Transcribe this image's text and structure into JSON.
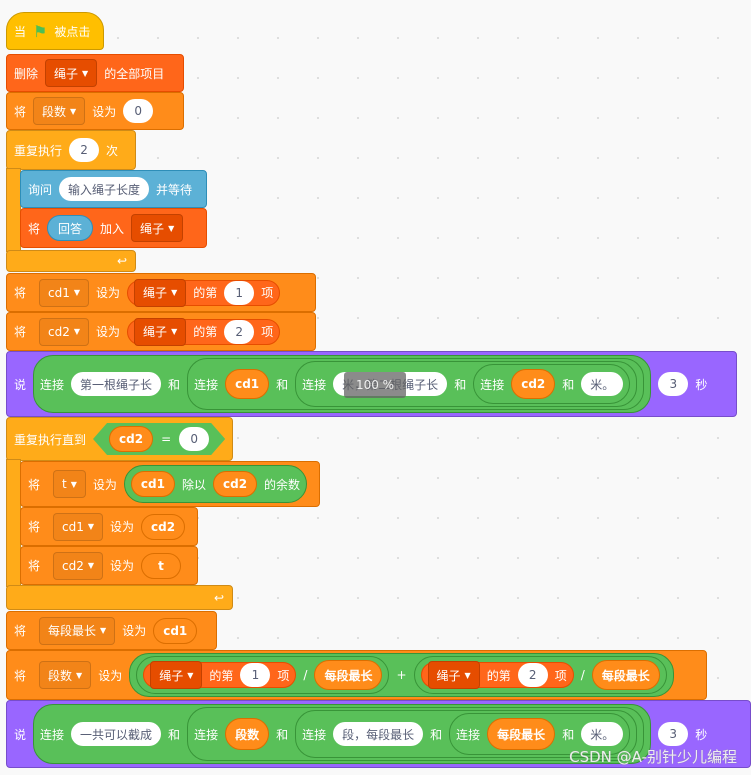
{
  "hat": {
    "when": "当",
    "flag_icon": "green-flag-icon",
    "clicked": "被点击"
  },
  "delete_all": {
    "label": "删除",
    "list": "绳子",
    "suffix": "的全部项目"
  },
  "set_segments": {
    "set": "将",
    "var": "段数",
    "to": "设为",
    "value": "0"
  },
  "repeat": {
    "label": "重复执行",
    "count": "2",
    "times": "次"
  },
  "ask": {
    "label": "询问",
    "question": "输入绳子长度",
    "wait": "并等待"
  },
  "add": {
    "set": "将",
    "answer": "回答",
    "add": "加入",
    "list": "绳子"
  },
  "set_cd1": {
    "set": "将",
    "var": "cd1",
    "to": "设为",
    "list": "绳子",
    "of": "的第",
    "index": "1",
    "item": "项"
  },
  "set_cd2": {
    "set": "将",
    "var": "cd2",
    "to": "设为",
    "list": "绳子",
    "of": "的第",
    "index": "2",
    "item": "项"
  },
  "say1": {
    "say": "说",
    "join": "连接",
    "and": "和",
    "text1": "第一根绳子长",
    "var1": "cd1",
    "text2": "米，第二根绳子长",
    "var2": "cd2",
    "text3": "米。",
    "secs": "3",
    "sec_label": "秒"
  },
  "zoom_indicator": "100 %",
  "repeat_until": {
    "label": "重复执行直到",
    "var": "cd2",
    "eq": "=",
    "value": "0"
  },
  "set_t": {
    "set": "将",
    "var": "t",
    "to": "设为",
    "a": "cd1",
    "mod": "除以",
    "b": "cd2",
    "rem": "的余数"
  },
  "set_cd1_cd2": {
    "set": "将",
    "var": "cd1",
    "to": "设为",
    "value": "cd2"
  },
  "set_cd2_t": {
    "set": "将",
    "var": "cd2",
    "to": "设为",
    "value": "t"
  },
  "set_max": {
    "set": "将",
    "var": "每段最长",
    "to": "设为",
    "value": "cd1"
  },
  "set_seg2": {
    "set": "将",
    "var": "段数",
    "to": "设为",
    "list": "绳子",
    "of": "的第",
    "i1": "1",
    "i2": "2",
    "item": "项",
    "div": "/",
    "plus": "+",
    "maxvar": "每段最长"
  },
  "say2": {
    "say": "说",
    "join": "连接",
    "and": "和",
    "text1": "一共可以截成",
    "var1": "段数",
    "text2": "段，每段最长",
    "var2": "每段最长",
    "text3": "米。",
    "secs": "3",
    "sec_label": "秒"
  },
  "watermark": "CSDN @A-别针少儿编程",
  "colors": {
    "events": "#FFBF00",
    "control": "#FFAB19",
    "variables": "#FF8C1A",
    "lists": "#FF661A",
    "sensing": "#5CB1D6",
    "looks": "#9966FF",
    "operators": "#59C059"
  }
}
